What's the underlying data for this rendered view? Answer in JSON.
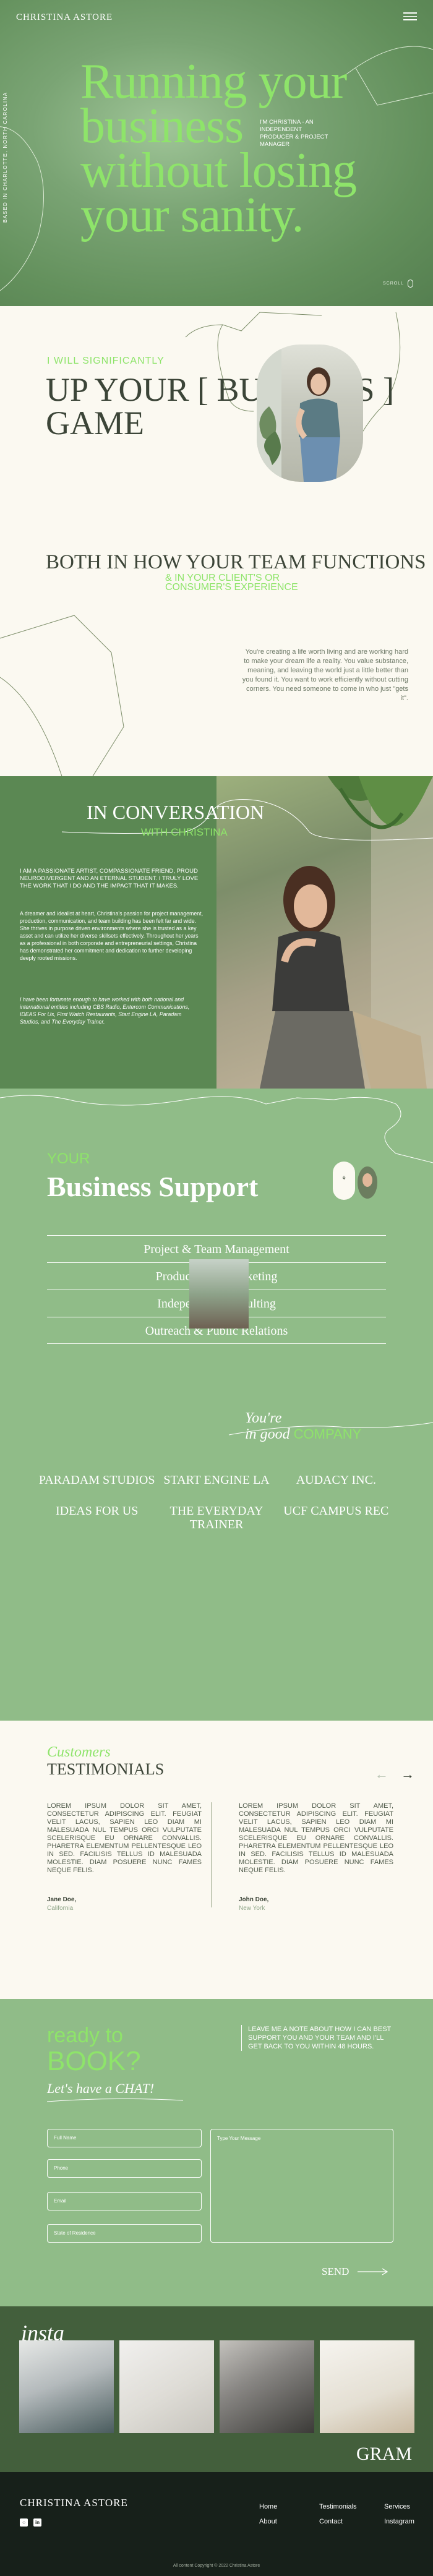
{
  "header": {
    "brand": "CHRISTINA ASTORE",
    "menu_icon": "hamburger-icon"
  },
  "hero": {
    "vertical_text": "BASED IN CHARLOTTE, NORTH CAROLINA",
    "title": "Running your business without losing your sanity.",
    "side_text": "I'M CHRISTINA - AN INDEPENDENT PRODUCER & PROJECT MANAGER",
    "scroll_label": "SCROLL"
  },
  "significant": {
    "pre": "I WILL SIGNIFICANTLY",
    "big": "UP YOUR [ BUSINESS ] GAME",
    "heading": "BOTH IN HOW YOUR TEAM FUNCTIONS",
    "heading_accent": "& IN YOUR CLIENT'S OR CONSUMER'S EXPERIENCE",
    "paragraph": "You're creating a life worth living and are working hard to make your dream life a reality. You value substance, meaning, and leaving the world just a little better than you found it. You want to work efficiently without cutting corners. You need someone to come in who just \"gets it\"."
  },
  "conversation": {
    "title": "IN CONVERSATION",
    "sub": "WITH CHRISTINA",
    "p1": "I AM A PASSIONATE ARTIST, COMPASSIONATE FRIEND, PROUD NEURODIVERGENT AND AN ETERNAL STUDENT. I TRULY LOVE THE WORK THAT I DO AND THE IMPACT THAT IT MAKES.",
    "p2": "A dreamer and idealist at heart, Christina's passion for project management, production, communication, and team building has been felt far and wide. She thrives in purpose driven environments where she is trusted as a key asset and can utilize her diverse skillsets effectively. Throughout her years as a professional in both corporate and entrepreneurial settings, Christina has demonstrated her commitment and dedication to further developing deeply rooted missions.",
    "p3": "I have been fortunate enough to have worked with both national and international entities including CBS Radio, Entercom Communications, IDEAS For Us, First Watch Restaurants, Start Engine LA, Paradam Studios, and The Everyday Trainer."
  },
  "support": {
    "your": "YOUR",
    "title": "Business Support",
    "services": [
      "Project & Team Management",
      "Production & Marketing",
      "Independent Consulting",
      "Outreach & Public Relations"
    ],
    "youre": "You're",
    "in_good": "in good",
    "company": "COMPANY",
    "clients": [
      "PARADAM STUDIOS",
      "START ENGINE LA",
      "AUDACY INC.",
      "IDEAS FOR US",
      "THE EVERYDAY TRAINER",
      "UCF CAMPUS REC"
    ]
  },
  "testimonials": {
    "customers": "Customers",
    "title": "TESTIMONIALS",
    "items": [
      {
        "text": "LOREM IPSUM DOLOR SIT AMET, CONSECTETUR ADIPISCING ELIT. FEUGIAT VELIT LACUS, SAPIEN LEO DIAM MI MALESUADA NUL TEMPUS ORCI VULPUTATE SCELERISQUE EU ORNARE CONVALLIS. PHARETRA ELEMENTUM PELLENTESQUE LEO IN SED. FACILISIS TELLUS ID MALESUADA MOLESTIE. DIAM POSUERE NUNC FAMES NEQUE FELIS.",
        "author": "Jane Doe,",
        "city": "California"
      },
      {
        "text": "LOREM IPSUM DOLOR SIT AMET, CONSECTETUR ADIPISCING ELIT. FEUGIAT VELIT LACUS, SAPIEN LEO DIAM MI MALESUADA NUL TEMPUS ORCI VULPUTATE SCELERISQUE EU ORNARE CONVALLIS. PHARETRA ELEMENTUM PELLENTESQUE LEO IN SED. FACILISIS TELLUS ID MALESUADA MOLESTIE. DIAM POSUERE NUNC FAMES NEQUE FELIS.",
        "author": "John Doe,",
        "city": "New York"
      }
    ]
  },
  "book": {
    "ready": "ready to",
    "book": "BOOK?",
    "lets": "Let's have a CHAT!",
    "note": "LEAVE ME A NOTE ABOUT HOW I CAN BEST SUPPORT YOU AND YOUR TEAM AND I'LL GET BACK TO YOU WITHIN 48 HOURS.",
    "fields": {
      "name": "Full Name",
      "phone": "Phone",
      "email": "Email",
      "residence": "State of Residence",
      "message": "Type Your Message"
    },
    "send": "SEND"
  },
  "instagram": {
    "insta": "insta",
    "gram": "GRAM"
  },
  "footer": {
    "logo": "CHRISTINA ASTORE",
    "links": [
      "Home",
      "About",
      "Testimonials",
      "Contact",
      "Services",
      "Instagram"
    ],
    "copyright": "All content Copyright © 2022 Christina Astore"
  }
}
